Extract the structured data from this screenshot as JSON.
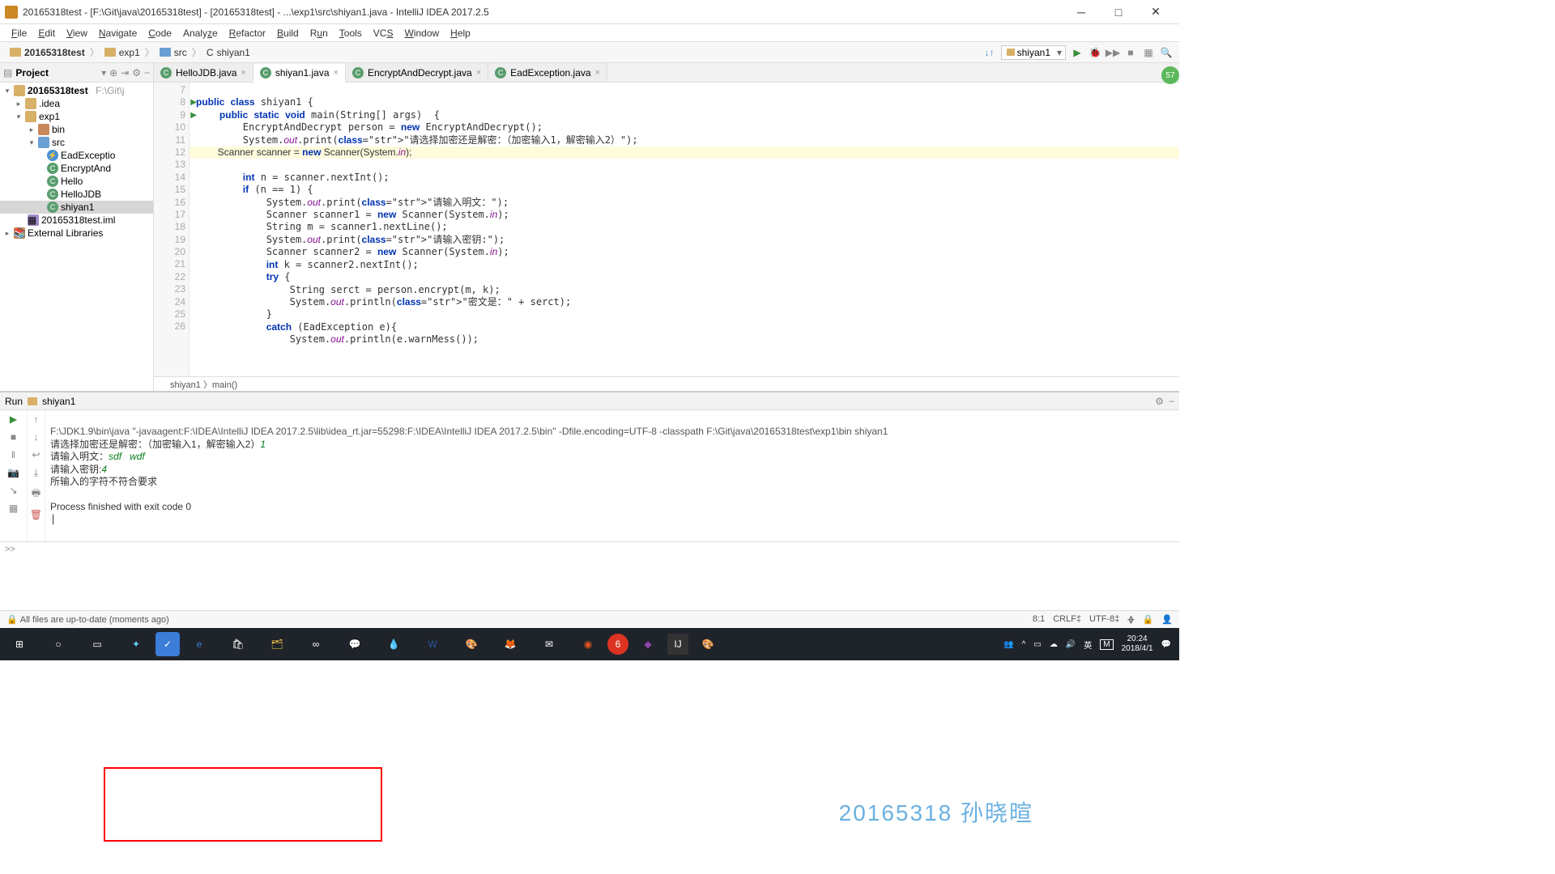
{
  "titlebar": {
    "text": "20165318test - [F:\\Git\\java\\20165318test] - [20165318test] - ...\\exp1\\src\\shiyan1.java - IntelliJ IDEA 2017.2.5"
  },
  "menu": {
    "file": "File",
    "edit": "Edit",
    "view": "View",
    "navigate": "Navigate",
    "code": "Code",
    "analyze": "Analyze",
    "refactor": "Refactor",
    "build": "Build",
    "run": "Run",
    "tools": "Tools",
    "vcs": "VCS",
    "window": "Window",
    "help": "Help"
  },
  "breadcrumb": {
    "items": [
      "20165318test",
      "exp1",
      "src",
      "shiyan1"
    ],
    "runconfig": "shiyan1"
  },
  "project": {
    "title": "Project",
    "root": "20165318test",
    "rootPath": "F:\\Git\\j",
    "nodes": {
      "idea": ".idea",
      "exp1": "exp1",
      "bin": "bin",
      "src": "src",
      "eadexc": "EadExceptio",
      "encdec": "EncryptAnd",
      "hello": "Hello",
      "hellojdb": "HelloJDB",
      "shiyan1": "shiyan1",
      "iml": "20165318test.iml",
      "extlib": "External Libraries"
    }
  },
  "tabs": [
    {
      "label": "HelloJDB.java",
      "active": false
    },
    {
      "label": "shiyan1.java",
      "active": true
    },
    {
      "label": "EncryptAndDecrypt.java",
      "active": false
    },
    {
      "label": "EadException.java",
      "active": false
    }
  ],
  "gutter_start": 7,
  "gutter_lines": [
    "7",
    "8",
    "9",
    "10",
    "11",
    "12",
    "13",
    "14",
    "15",
    "16",
    "17",
    "18",
    "19",
    "20",
    "21",
    "22",
    "23",
    "24",
    "25",
    "26"
  ],
  "code": {
    "l7": "",
    "l8": "public class shiyan1 {",
    "l9": "    public static void main(String[] args)  {",
    "l10": "        EncryptAndDecrypt person = new EncryptAndDecrypt();",
    "l11": "        System.out.print(\"请选择加密还是解密：（加密输入1，解密输入2）\");",
    "l12": "        Scanner scanner = new Scanner(System.in);",
    "l13": "        int n = scanner.nextInt();",
    "l14": "        if (n == 1) {",
    "l15": "            System.out.print(\"请输入明文：\");",
    "l16": "            Scanner scanner1 = new Scanner(System.in);",
    "l17": "            String m = scanner1.nextLine();",
    "l18": "            System.out.print(\"请输入密钥:\");",
    "l19": "            Scanner scanner2 = new Scanner(System.in);",
    "l20": "            int k = scanner2.nextInt();",
    "l21": "            try {",
    "l22": "                String serct = person.encrypt(m, k);",
    "l23": "                System.out.println(\"密文是：\" + serct);",
    "l24": "            }",
    "l25": "            catch (EadException e){",
    "l26": "                System.out.println(e.warnMess());"
  },
  "code_crumb": "shiyan1 〉main()",
  "badge57": "57",
  "run": {
    "tab": "Run",
    "label": "shiyan1",
    "cmd": "F:\\JDK1.9\\bin\\java \"-javaagent:F:\\IDEA\\IntelliJ IDEA 2017.2.5\\lib\\idea_rt.jar=55298:F:\\IDEA\\IntelliJ IDEA 2017.2.5\\bin\" -Dfile.encoding=UTF-8 -classpath F:\\Git\\java\\20165318test\\exp1\\bin shiyan1",
    "l1": "请选择加密还是解密：（加密输入1，解密输入2）",
    "i1": "1",
    "l2": "请输入明文：",
    "i2": "sdf   wdf",
    "l3": "请输入密钥:",
    "i3": "4",
    "l4": "所输入的字符不符合要求",
    "exit": "Process finished with exit code 0",
    "footer": ">>"
  },
  "watermark": "20165318 孙晓暄",
  "status": {
    "left": "All files are up-to-date (moments ago)",
    "pos": "8:1",
    "crlf": "CRLF‡",
    "enc": "UTF-8‡"
  },
  "taskbar": {
    "time": "20:24",
    "date": "2018/4/1",
    "lang": "英",
    "m": "M"
  }
}
